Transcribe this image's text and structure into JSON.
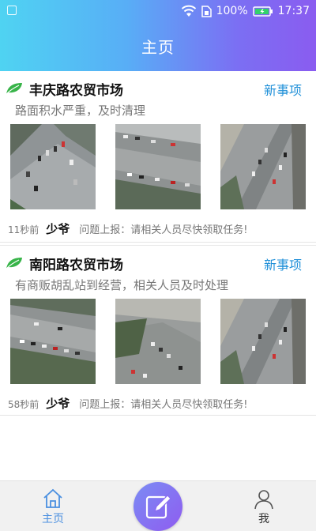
{
  "status_bar": {
    "battery_percent": "100%",
    "time": "17:37",
    "icons": [
      "notification-icon",
      "wifi-icon",
      "sim-icon",
      "battery-icon"
    ]
  },
  "header": {
    "title": "主页"
  },
  "feed": [
    {
      "market": "丰庆路农贸市场",
      "action": "新事项",
      "description": "路面积水严重，及时清理",
      "time": "11秒前",
      "user": "少爷",
      "report": "问题上报：请相关人员尽快领取任务!"
    },
    {
      "market": "南阳路农贸市场",
      "action": "新事项",
      "description": "有商贩胡乱站到经营，相关人员及时处理",
      "time": "58秒前",
      "user": "少爷",
      "report": "问题上报：请相关人员尽快领取任务!"
    }
  ],
  "tabbar": {
    "home_label": "主页",
    "me_label": "我",
    "fab_icon": "edit-icon"
  },
  "colors": {
    "header_gradient": [
      "#4fd3f2",
      "#58aef6",
      "#7b6ff3",
      "#8a5cf0"
    ],
    "accent_link": "#1e8fd8",
    "leaf": "#38b449",
    "tab_active": "#4a8fe0",
    "fab": "#8a6cf2"
  }
}
